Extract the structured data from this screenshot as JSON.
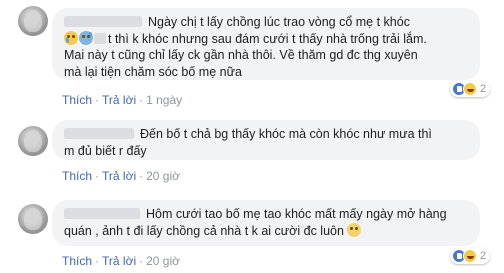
{
  "comments": [
    {
      "line1": "Ngày chị t lấy chồng lúc trao vòng cổ mẹ t khóc",
      "line2": "t thì k khóc nhưng sau đám cưới t thấy nhà trống trải lắm.",
      "line3": "Mai này t cũng chỉ lấy ck gần nhà thôi. Về thăm gd đc thg xuyên",
      "line4": "mà lại tiện chăm sóc bố mẹ nữa",
      "like_label": "Thích",
      "reply_label": "Trả lời",
      "time": "1 ngày",
      "reaction_count": "2"
    },
    {
      "line1": "Đến bố t chả bg thấy khóc mà còn khóc như mưa thì",
      "line2": "m đủ biết r đấy",
      "like_label": "Thích",
      "reply_label": "Trả lời",
      "time": "20 giờ"
    },
    {
      "line1": "Hôm cưới tao bố mẹ tao khóc mất mấy ngày mở hàng",
      "line2": "quán , ảnh t đi lấy chồng cả nhà t k ai cười đc luôn",
      "like_label": "Thích",
      "reply_label": "Trả lời",
      "time": "20 giờ",
      "reaction_count": "2"
    }
  ]
}
